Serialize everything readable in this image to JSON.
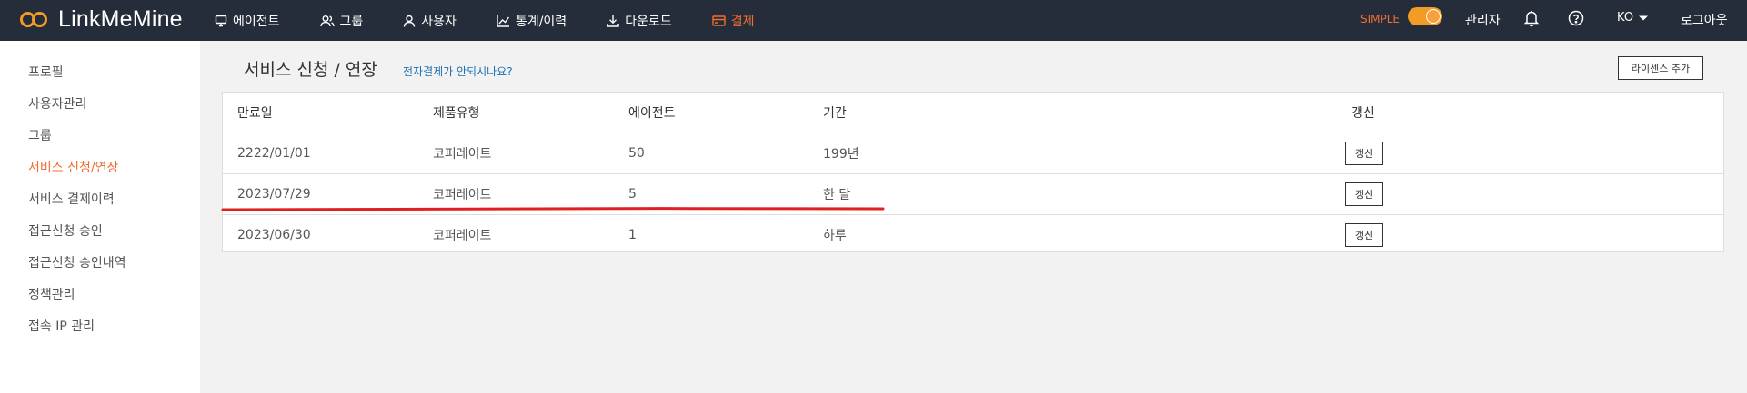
{
  "brand": {
    "name": "LinkMeMine",
    "accent_color": "#f39c25"
  },
  "nav": {
    "items": [
      {
        "label": "에이전트",
        "icon": "monitor-icon"
      },
      {
        "label": "그룹",
        "icon": "users-icon"
      },
      {
        "label": "사용자",
        "icon": "user-icon"
      },
      {
        "label": "통계/이력",
        "icon": "chart-icon"
      },
      {
        "label": "다운로드",
        "icon": "download-icon"
      },
      {
        "label": "결제",
        "icon": "card-icon",
        "active": true
      }
    ],
    "mode_label": "SIMPLE",
    "mode_on": true,
    "admin": "관리자",
    "lang": "KO",
    "logout": "로그아웃"
  },
  "sidebar": {
    "items": [
      {
        "label": "프로필"
      },
      {
        "label": "사용자관리"
      },
      {
        "label": "그룹"
      },
      {
        "label": "서비스 신청/연장",
        "active": true
      },
      {
        "label": "서비스 결제이력"
      },
      {
        "label": "접근신청 승인"
      },
      {
        "label": "접근신청 승인내역"
      },
      {
        "label": "정책관리"
      },
      {
        "label": "접속 IP 관리"
      }
    ]
  },
  "main": {
    "title": "서비스 신청 / 연장",
    "help_link": "전자결제가 안되시나요?",
    "add_license_label": "라이센스 추가",
    "table": {
      "headers": [
        "만료일",
        "제품유형",
        "에이전트",
        "기간",
        "갱신"
      ],
      "rows": [
        {
          "expiry": "2222/01/01",
          "product": "코퍼레이트",
          "agents": "50",
          "period": "199년",
          "renew": "갱신"
        },
        {
          "expiry": "2023/07/29",
          "product": "코퍼레이트",
          "agents": "5",
          "period": "한 달",
          "renew": "갱신"
        },
        {
          "expiry": "2023/06/30",
          "product": "코퍼레이트",
          "agents": "1",
          "period": "하루",
          "renew": "갱신"
        }
      ]
    }
  },
  "colors": {
    "topbar": "#262d3a",
    "active": "#f06e30",
    "link": "#1a6fb3",
    "annotation": "#e02020"
  }
}
